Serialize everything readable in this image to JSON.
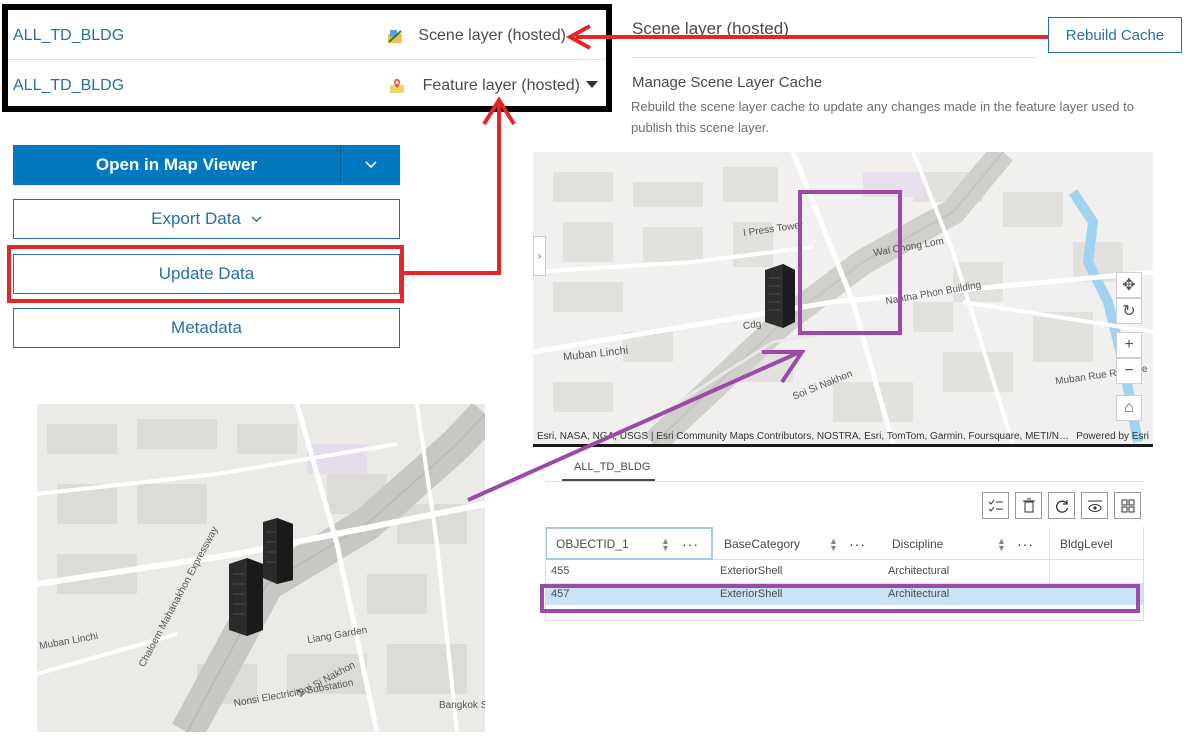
{
  "layers": [
    {
      "name": "ALL_TD_BLDG",
      "type": "Scene layer (hosted)",
      "icon": "scene-layer-icon"
    },
    {
      "name": "ALL_TD_BLDG",
      "type": "Feature layer (hosted)",
      "icon": "feature-layer-icon"
    }
  ],
  "scene_panel": {
    "title": "Scene layer (hosted)",
    "rebuild_label": "Rebuild Cache",
    "manage_title": "Manage Scene Layer Cache",
    "manage_desc": "Rebuild the scene layer cache to update any changes made in the feature layer used to publish this scene layer."
  },
  "actions": {
    "open_map_viewer": "Open in Map Viewer",
    "export_data": "Export Data",
    "update_data": "Update Data",
    "metadata": "Metadata"
  },
  "map_right": {
    "attribution": "Esri, NASA, NGA, USGS | Esri Community Maps Contributors, NOSTRA, Esri, TomTom, Garmin, Foursquare, METI/N…",
    "powered_by": "Powered by Esri",
    "labels": [
      "Muban Linchi",
      "Soi Si Nakhon",
      "Nantha Phon Building",
      "Wai Chong Lom",
      "Muban Rue Rungrue",
      "Cdg",
      "I Press Tower"
    ]
  },
  "map_left": {
    "labels": [
      "Chaloem Mahanakhon Expressway",
      "Muban Linchi",
      "Soi Si Nakhon",
      "Nonsi Electricity Substation",
      "Liang Garden",
      "Bangkok Service"
    ]
  },
  "table": {
    "tab": "ALL_TD_BLDG",
    "columns": [
      "OBJECTID_1",
      "BaseCategory",
      "Discipline",
      "BldgLevel"
    ],
    "rows": [
      [
        "455",
        "ExteriorShell",
        "Architectural",
        ""
      ],
      [
        "457",
        "ExteriorShell",
        "Architectural",
        ""
      ]
    ],
    "tools": [
      "checklist-icon",
      "trash-icon",
      "refresh-icon",
      "show-hide-icon",
      "grid-icon"
    ]
  },
  "colors": {
    "accent": "#0079c1",
    "annotation_red": "#e4262b",
    "annotation_purple": "#9b4aa8",
    "selection": "#c9e2f5"
  }
}
